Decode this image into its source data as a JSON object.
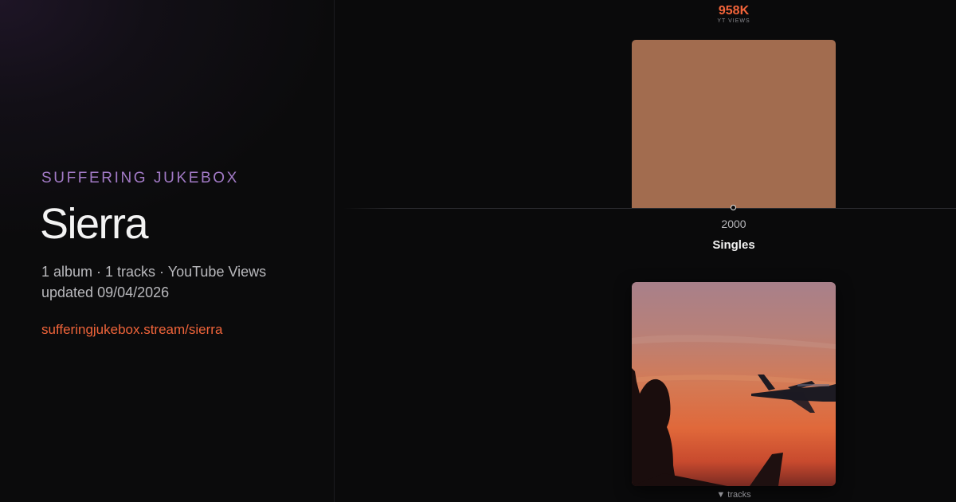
{
  "header": {
    "brand": "SUFFERING JUKEBOX",
    "artist": "Sierra",
    "summary": "1 album · 1 tracks · YouTube Views",
    "updated": "updated 09/04/2026",
    "link": "sufferingjukebox.stream/sierra"
  },
  "album": {
    "views_value": "958K",
    "views_label": "YT VIEWS",
    "year": "2000",
    "title": "Singles",
    "cover_icon": "album-cover-sunset-airplane",
    "bar_fraction": 1.0,
    "tracks_toggle": "▼ tracks"
  },
  "colors": {
    "accent": "#f0643a",
    "brand": "#a27ac6",
    "bar": "#a26c4f",
    "background": "#0a0a0b"
  }
}
